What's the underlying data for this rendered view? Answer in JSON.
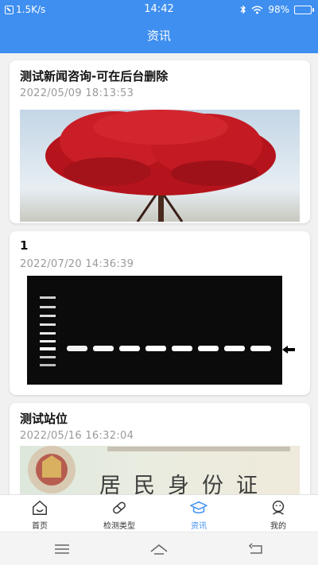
{
  "status_bar": {
    "net_speed": "1.5K/s",
    "time": "14:42",
    "battery": "98%",
    "battery_level": 0.98,
    "icons": [
      "network-speed-icon",
      "bluetooth-icon",
      "wifi-icon",
      "battery-icon"
    ]
  },
  "header": {
    "title": "资讯"
  },
  "news": [
    {
      "title": "测试新闻咨询-可在后台删除",
      "date": "2022/05/09 18:13:53",
      "image": "red-tree-photo"
    },
    {
      "title": "1",
      "date": "2022/07/20 14:36:39",
      "image": "gel-electrophoresis-photo"
    },
    {
      "title": "测试站位",
      "date": "2022/05/16 16:32:04",
      "image": "id-card-photo",
      "image_text": "居民身份证"
    }
  ],
  "tabs": [
    {
      "label": "首页",
      "icon": "home-icon",
      "active": false
    },
    {
      "label": "检测类型",
      "icon": "test-type-icon",
      "active": false
    },
    {
      "label": "资讯",
      "icon": "graduation-cap-icon",
      "active": true
    },
    {
      "label": "我的",
      "icon": "profile-icon",
      "active": false
    }
  ],
  "colors": {
    "primary": "#3f8ff0",
    "background": "#f1f1f1",
    "inactive": "#333333"
  }
}
